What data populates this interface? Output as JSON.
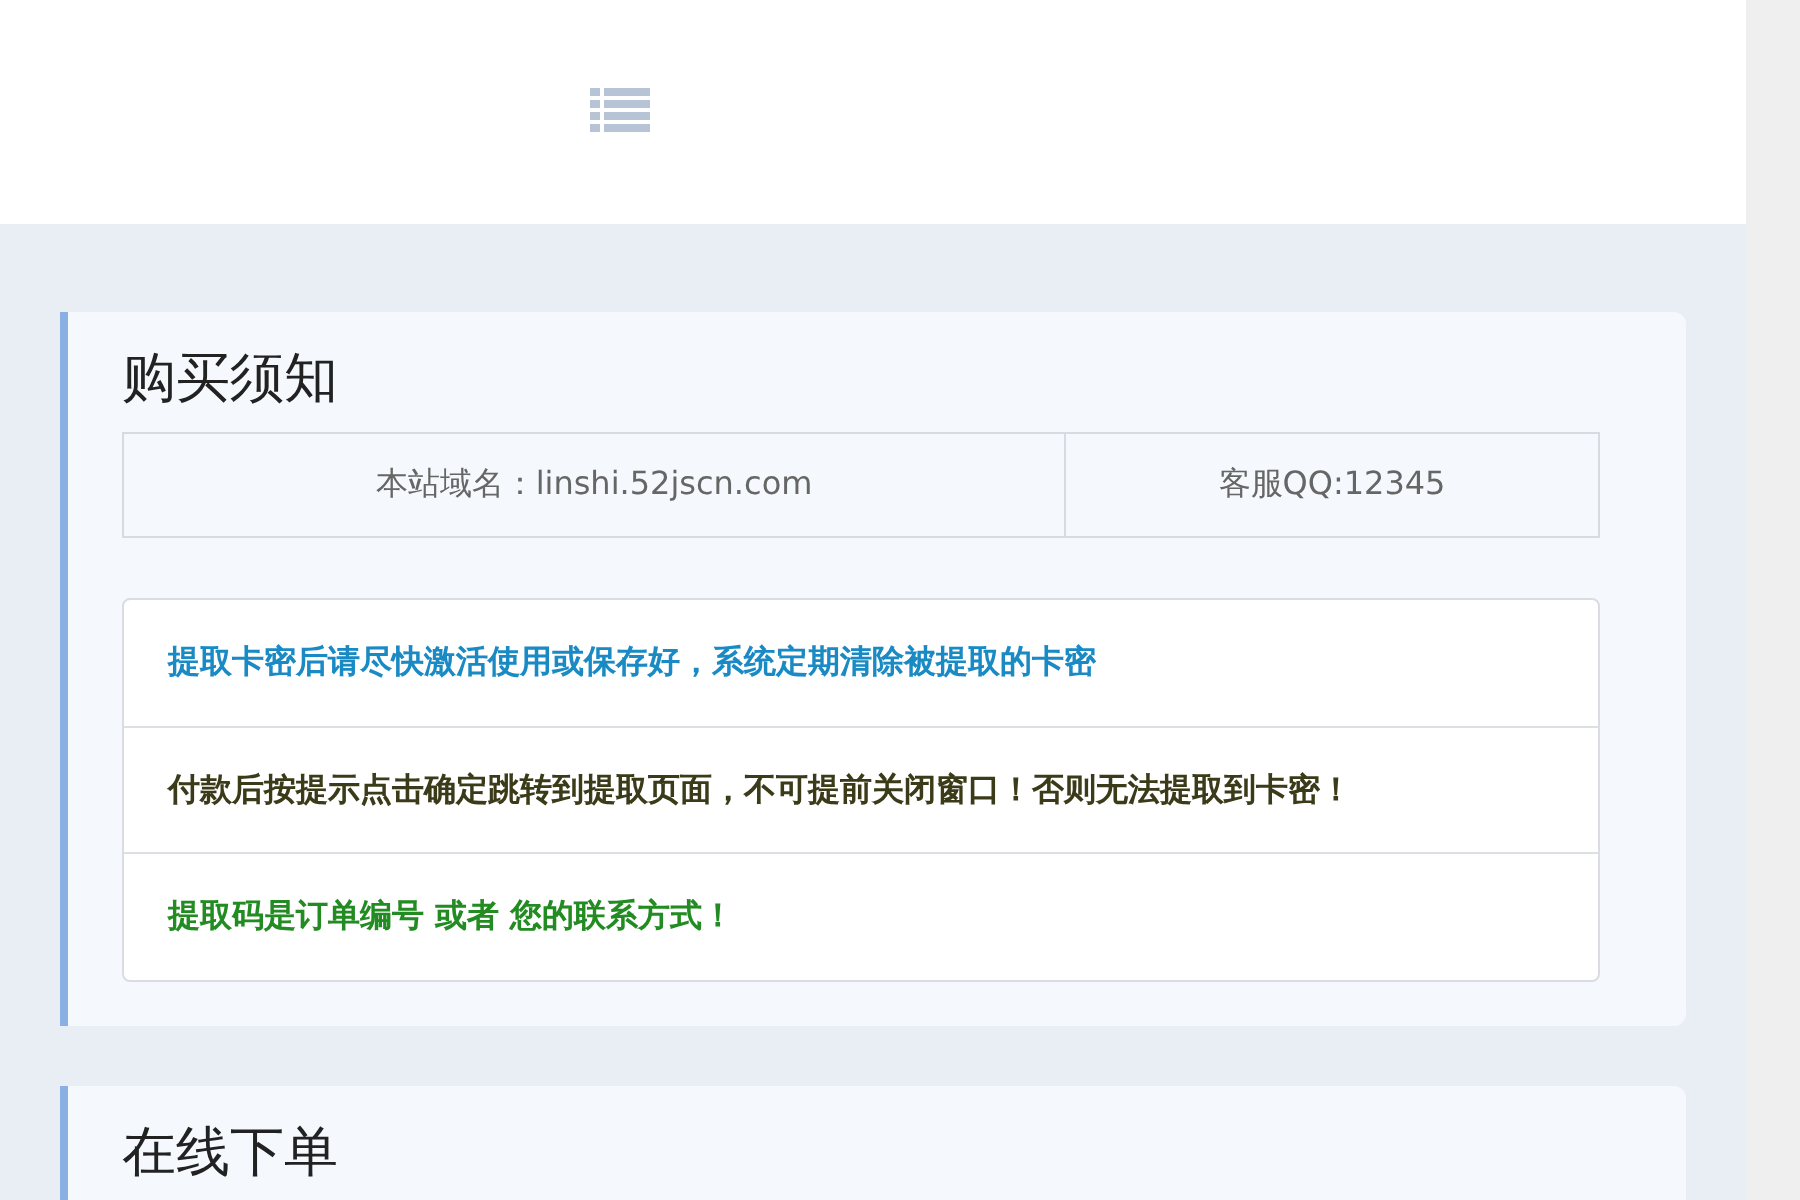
{
  "cards": [
    {
      "title": "购买须知",
      "info": [
        "本站域名：linshi.52jscn.com",
        "客服QQ:12345"
      ],
      "notices": [
        {
          "text": "提取卡密后请尽快激活使用或保存好，系统定期清除被提取的卡密",
          "color": "#1a8ac4"
        },
        {
          "text": "付款后按提示点击确定跳转到提取页面，不可提前关闭窗口！否则无法提取到卡密！",
          "color": "#3b3b1a"
        },
        {
          "text": "提取码是订单编号 或者 您的联系方式！",
          "color": "#228b22"
        }
      ]
    },
    {
      "title": "在线下单"
    }
  ]
}
